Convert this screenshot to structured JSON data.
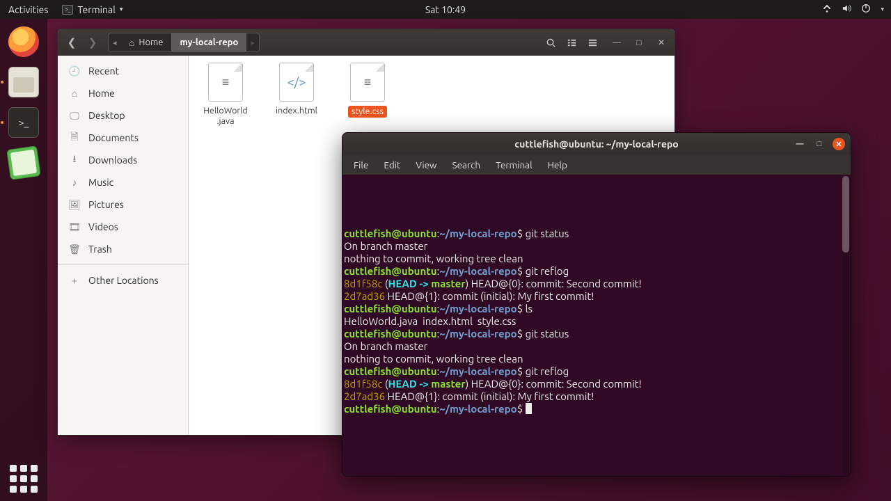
{
  "topbar": {
    "activities": "Activities",
    "app_menu": "Terminal",
    "clock": "Sat 10:49"
  },
  "fm": {
    "path": {
      "home": "Home",
      "current": "my-local-repo"
    },
    "sidebar": {
      "recent": "Recent",
      "home": "Home",
      "desktop": "Desktop",
      "documents": "Documents",
      "downloads": "Downloads",
      "music": "Music",
      "pictures": "Pictures",
      "videos": "Videos",
      "trash": "Trash",
      "other": "Other Locations"
    },
    "files": {
      "f0": "HelloWorld\n.java",
      "f1": "index.html",
      "f2": "style.css"
    }
  },
  "term": {
    "title": "cuttlefish@ubuntu: ~/my-local-repo",
    "menu": {
      "file": "File",
      "edit": "Edit",
      "view": "View",
      "search": "Search",
      "terminal": "Terminal",
      "help": "Help"
    },
    "prompt_user": "cuttlefish@ubuntu",
    "prompt_path": "~/my-local-repo",
    "cmds": {
      "status": "git status",
      "reflog": "git reflog",
      "ls": "ls"
    },
    "out": {
      "branch": "On branch master",
      "clean": "nothing to commit, working tree clean",
      "ls_line": "HelloWorld.java  index.html  style.css",
      "hash1": "8d1f58c",
      "hash2": "2d7ad36",
      "ref_head": "HEAD -> master",
      "ref0_rest": " HEAD@{0}: commit: Second commit!",
      "ref1_rest": " HEAD@{1}: commit (initial): My first commit!"
    }
  }
}
